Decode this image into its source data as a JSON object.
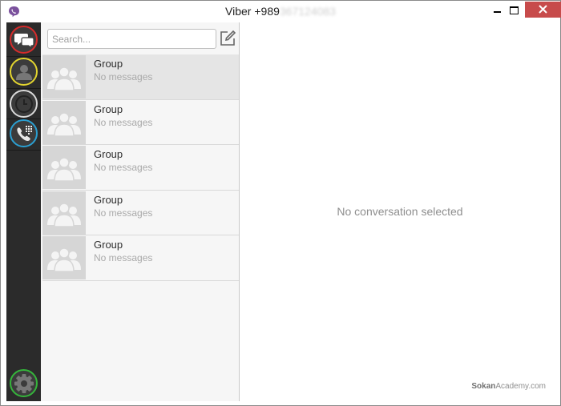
{
  "window": {
    "title_prefix": "Viber +989",
    "title_masked": "367124083",
    "buttons": {
      "minimize": "minimize",
      "maximize": "maximize",
      "close": "close"
    }
  },
  "nav": {
    "items": [
      {
        "name": "chats",
        "icon": "chat-bubbles-icon",
        "color": "#d62b2b"
      },
      {
        "name": "contacts",
        "icon": "contact-person-icon",
        "color": "#e3d52f"
      },
      {
        "name": "recents",
        "icon": "clock-icon",
        "color": "#d9d9d9"
      },
      {
        "name": "dialpad",
        "icon": "phone-dialpad-icon",
        "color": "#2b9fd1"
      }
    ],
    "settings": {
      "icon": "gear-icon",
      "color": "#35b53b"
    }
  },
  "search": {
    "placeholder": "Search...",
    "value": ""
  },
  "conversations": [
    {
      "name": "Group",
      "preview": "No messages"
    },
    {
      "name": "Group",
      "preview": "No messages"
    },
    {
      "name": "Group",
      "preview": "No messages"
    },
    {
      "name": "Group",
      "preview": "No messages"
    },
    {
      "name": "Group",
      "preview": "No messages"
    }
  ],
  "main": {
    "empty_text": "No conversation selected",
    "watermark_bold": "Sokan",
    "watermark_rest": "Academy.com"
  },
  "colors": {
    "accent_close": "#c74b4b",
    "rail": "#2b2b2b",
    "viber_purple": "#7b519d"
  }
}
